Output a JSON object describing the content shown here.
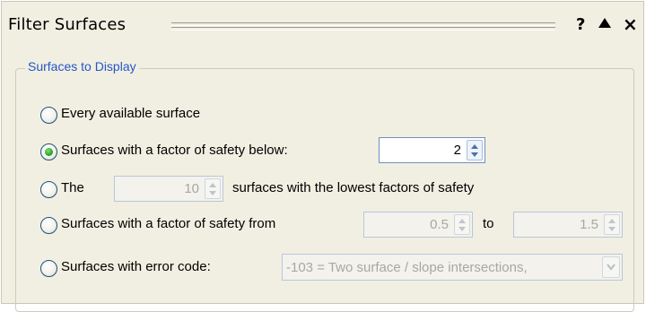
{
  "panel": {
    "title": "Filter Surfaces",
    "help_label": "?",
    "close_label": "×"
  },
  "group": {
    "legend": "Surfaces to Display",
    "options": [
      {
        "label": "Every available surface",
        "selected": false
      },
      {
        "label": "Surfaces with a factor of safety below:",
        "selected": true,
        "value": "2"
      },
      {
        "label_before": "The",
        "value": "10",
        "label_after": "surfaces with the lowest factors of safety",
        "selected": false
      },
      {
        "label": "Surfaces with a factor of safety from",
        "from": "0.5",
        "to_label": "to",
        "to": "1.5",
        "selected": false
      },
      {
        "label": "Surfaces with error code:",
        "selected": false,
        "error_value": "-103 = Two surface / slope intersections,"
      }
    ]
  }
}
